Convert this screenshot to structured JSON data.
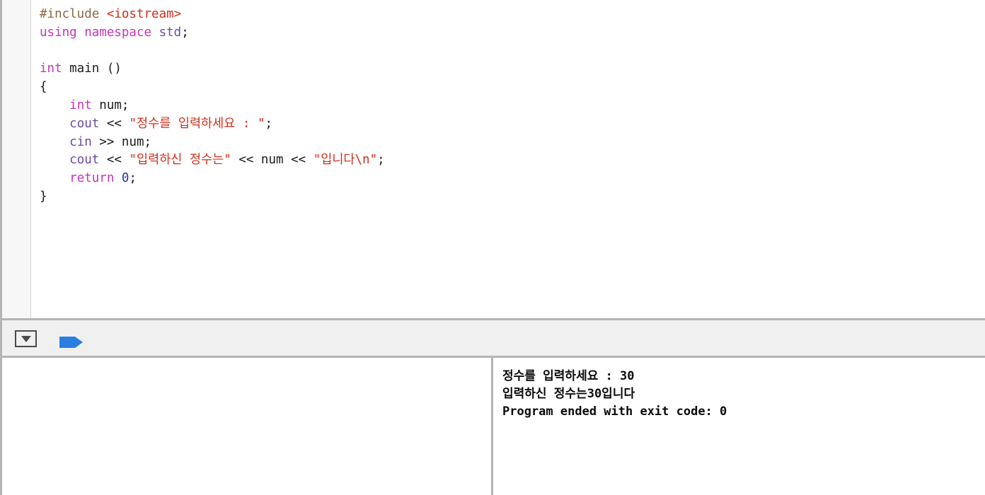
{
  "editor": {
    "name": "source-code-editor",
    "language": "C++",
    "lines": [
      {
        "id": 1,
        "tokens": [
          {
            "text": "#include ",
            "cls": "t-pre"
          },
          {
            "text": "<iostream>",
            "cls": "t-header"
          }
        ]
      },
      {
        "id": 2,
        "tokens": [
          {
            "text": "using namespace ",
            "cls": "t-kw"
          },
          {
            "text": "std",
            "cls": "t-type"
          },
          {
            "text": ";",
            "cls": "t-plain"
          }
        ]
      },
      {
        "id": 3,
        "tokens": [
          {
            "text": "",
            "cls": "t-plain"
          }
        ]
      },
      {
        "id": 4,
        "tokens": [
          {
            "text": "int",
            "cls": "t-kw"
          },
          {
            "text": " main ()",
            "cls": "t-plain"
          }
        ]
      },
      {
        "id": 5,
        "tokens": [
          {
            "text": "{",
            "cls": "t-plain"
          }
        ]
      },
      {
        "id": 6,
        "tokens": [
          {
            "text": "    ",
            "cls": "t-plain"
          },
          {
            "text": "int",
            "cls": "t-kw"
          },
          {
            "text": " num;",
            "cls": "t-plain"
          }
        ]
      },
      {
        "id": 7,
        "tokens": [
          {
            "text": "    ",
            "cls": "t-plain"
          },
          {
            "text": "cout",
            "cls": "t-type"
          },
          {
            "text": " << ",
            "cls": "t-plain"
          },
          {
            "text": "\"정수를 입력하세요 : \"",
            "cls": "t-str"
          },
          {
            "text": ";",
            "cls": "t-plain"
          }
        ]
      },
      {
        "id": 8,
        "tokens": [
          {
            "text": "    ",
            "cls": "t-plain"
          },
          {
            "text": "cin",
            "cls": "t-type"
          },
          {
            "text": " >> num;",
            "cls": "t-plain"
          }
        ]
      },
      {
        "id": 9,
        "tokens": [
          {
            "text": "    ",
            "cls": "t-plain"
          },
          {
            "text": "cout",
            "cls": "t-type"
          },
          {
            "text": " << ",
            "cls": "t-plain"
          },
          {
            "text": "\"입력하신 정수는\"",
            "cls": "t-str"
          },
          {
            "text": " << num << ",
            "cls": "t-plain"
          },
          {
            "text": "\"입니다\\n\"",
            "cls": "t-str"
          },
          {
            "text": ";",
            "cls": "t-plain"
          }
        ]
      },
      {
        "id": 10,
        "tokens": [
          {
            "text": "    ",
            "cls": "t-plain"
          },
          {
            "text": "return",
            "cls": "t-kw"
          },
          {
            "text": " ",
            "cls": "t-plain"
          },
          {
            "text": "0",
            "cls": "t-num"
          },
          {
            "text": ";",
            "cls": "t-plain"
          }
        ]
      },
      {
        "id": 11,
        "tokens": [
          {
            "text": "}",
            "cls": "t-plain"
          }
        ]
      }
    ]
  },
  "toolbar": {
    "dropdown_label": "chevron-down",
    "arrow_label": "step-arrow"
  },
  "console": {
    "variables_pane_placeholder": "",
    "output_lines": [
      "정수를 입력하세요 : 30",
      "입력하신 정수는30입니다",
      "Program ended with exit code: 0"
    ]
  },
  "colors": {
    "preprocessor": "#8a6a42",
    "header": "#d12f1b",
    "keyword": "#c634b5",
    "type": "#6a4ca8",
    "string": "#d12f1b",
    "number": "#2a2fb8",
    "plain": "#1b1b1b",
    "toolbar_bg": "#f0f0f0",
    "arrow_blue": "#2a7de1",
    "rail_gray": "#b4b4b4"
  }
}
